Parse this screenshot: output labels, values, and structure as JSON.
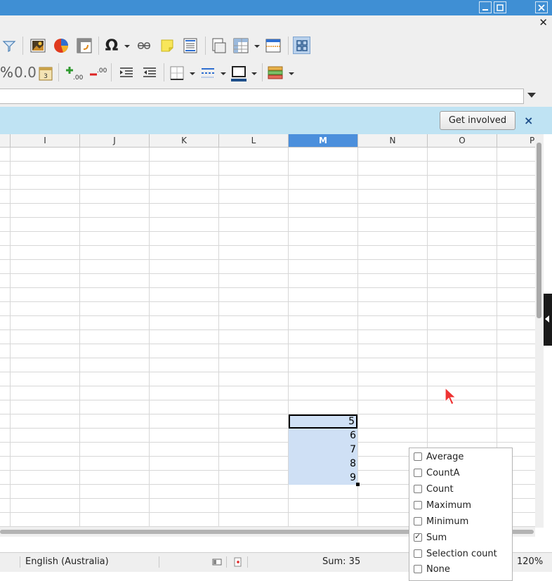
{
  "infobar": {
    "button_label": "Get involved",
    "close_icon": "×"
  },
  "toolbar2": {
    "percent": "%",
    "decimal": "0.0"
  },
  "columns": [
    "I",
    "J",
    "K",
    "L",
    "M",
    "N",
    "O",
    "P"
  ],
  "selected_column": "M",
  "cells": [
    "5",
    "6",
    "7",
    "8",
    "9"
  ],
  "status": {
    "language": "English (Australia)",
    "sum": "Sum: 35",
    "zoom": "120%"
  },
  "popup": {
    "items": [
      {
        "label": "Average",
        "checked": false
      },
      {
        "label": "CountA",
        "checked": false
      },
      {
        "label": "Count",
        "checked": false
      },
      {
        "label": "Maximum",
        "checked": false
      },
      {
        "label": "Minimum",
        "checked": false
      },
      {
        "label": "Sum",
        "checked": true
      },
      {
        "label": "Selection count",
        "checked": false
      },
      {
        "label": "None",
        "checked": false
      }
    ]
  },
  "colors": {
    "titlebar": "#3f8fd4",
    "selection": "#cfe0f5",
    "selected_header": "#4b8fdc",
    "infobar": "#bfe3f3"
  }
}
